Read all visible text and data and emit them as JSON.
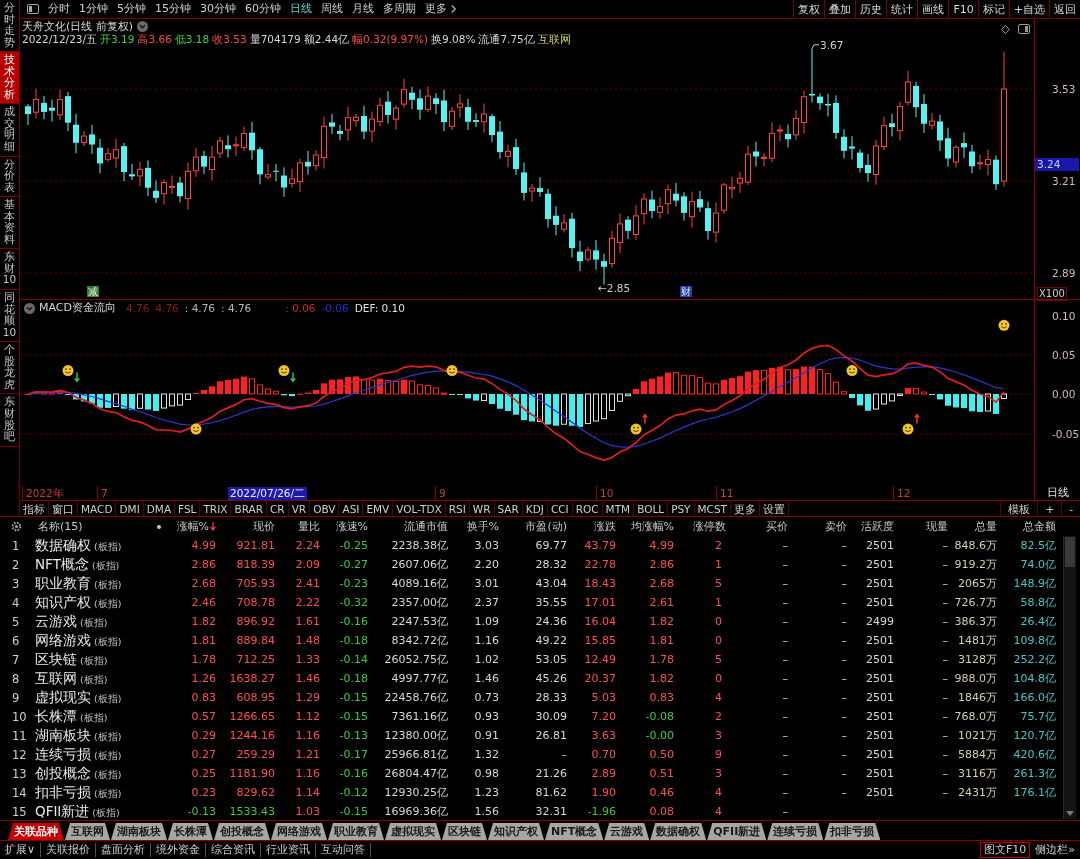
{
  "sidebar": {
    "items": [
      {
        "label": "分时走势",
        "selected": false
      },
      {
        "label": "技术分析",
        "selected": true
      },
      {
        "label": "成交明细",
        "selected": false
      },
      {
        "label": "分价表",
        "selected": false
      },
      {
        "label": "基本资料",
        "selected": false
      },
      {
        "label": "东财10",
        "selected": false
      },
      {
        "label": "同花顺10",
        "selected": false
      },
      {
        "label": "个股龙虎",
        "selected": false
      },
      {
        "label": "东财股吧",
        "selected": false
      }
    ]
  },
  "toolbar": {
    "periods": [
      {
        "label": "分时",
        "selected": false
      },
      {
        "label": "1分钟",
        "selected": false
      },
      {
        "label": "5分钟",
        "selected": false
      },
      {
        "label": "15分钟",
        "selected": false
      },
      {
        "label": "30分钟",
        "selected": false
      },
      {
        "label": "60分钟",
        "selected": false
      },
      {
        "label": "日线",
        "selected": true
      },
      {
        "label": "周线",
        "selected": false
      },
      {
        "label": "月线",
        "selected": false
      },
      {
        "label": "多周期",
        "selected": false
      },
      {
        "label": "更多",
        "selected": false
      }
    ],
    "actions": [
      "复权",
      "叠加",
      "历史",
      "统计",
      "画线",
      "F10",
      "标记",
      "+自选",
      "返回"
    ]
  },
  "price_chart": {
    "title": "天舟文化(日线 前复权)",
    "date": "2022/12/23/五",
    "quote": [
      {
        "label": "开",
        "value": "3.19",
        "color": "#3cd03c"
      },
      {
        "label": "高",
        "value": "3.66",
        "color": "#ff4848"
      },
      {
        "label": "低",
        "value": "3.18",
        "color": "#3cd03c"
      },
      {
        "label": "收",
        "value": "3.53",
        "color": "#ff4848"
      },
      {
        "label": "量",
        "value": "704179",
        "color": "#d8d8d8"
      },
      {
        "label": "额",
        "value": "2.44亿",
        "color": "#d8d8d8"
      },
      {
        "label": "幅",
        "value": "0.32(9.97%)",
        "color": "#ff4848"
      },
      {
        "label": "换",
        "value": "9.08%",
        "color": "#d8d8d8"
      },
      {
        "label": "流通",
        "value": "7.75亿",
        "color": "#d8d8d8"
      }
    ],
    "sector": "互联网",
    "high_label": "3.67",
    "low_label": "←2.85",
    "markers": [
      {
        "text": "减",
        "kind": "reduce"
      },
      {
        "text": "财",
        "kind": "finance"
      }
    ],
    "axis_labels": [
      "3.53",
      "3.21",
      "2.89"
    ],
    "current_price": "3.24",
    "scale_label": "X100"
  },
  "macd_chart": {
    "title": "MACD资金流向",
    "legend": [
      {
        "text": "4.76",
        "color": "#8b1c1c"
      },
      {
        "text": "4.76",
        "color": "#8b1c1c"
      },
      {
        "text": ": 4.76",
        "color": "#b8b8b8"
      },
      {
        "text": ": 4.76",
        "color": "#b8b8b8"
      },
      {
        "text": ": 0.06",
        "color": "#d02424"
      },
      {
        "text": "-0.06",
        "color": "#2a2ad0"
      },
      {
        "text": "DEF: 0.10",
        "color": "#e0e0e0"
      }
    ],
    "axis_labels": [
      "0.10",
      "0.05",
      "0.00",
      "-0.05"
    ]
  },
  "time_axis": {
    "labels": [
      "2022年",
      "7",
      "9",
      "10",
      "11",
      "12"
    ],
    "cursor_date": "2022/07/26/二",
    "period": "日线"
  },
  "indicator_tabs": {
    "items": [
      "指标",
      "窗口",
      "MACD",
      "DMI",
      "DMA",
      "FSL",
      "TRIX",
      "BRAR",
      "CR",
      "VR",
      "OBV",
      "ASI",
      "EMV",
      "VOL-TDX",
      "RSI",
      "WR",
      "SAR",
      "KDJ",
      "CCI",
      "ROC",
      "MTM",
      "BOLL",
      "PSY",
      "MCST",
      "更多",
      "设置"
    ],
    "tools": [
      "模板",
      "+",
      "-"
    ]
  },
  "table": {
    "columns": [
      {
        "label": "名称(15)",
        "kind": "name",
        "sorted": false
      },
      {
        "label": "涨幅%",
        "kind": "signed",
        "sorted": true
      },
      {
        "label": "现价",
        "kind": "signed",
        "sorted": false
      },
      {
        "label": "量比",
        "kind": "signed",
        "sorted": false
      },
      {
        "label": "涨速%",
        "kind": "signed",
        "sorted": false
      },
      {
        "label": "流通市值",
        "kind": "plain",
        "sorted": false
      },
      {
        "label": "换手%",
        "kind": "plain",
        "sorted": false
      },
      {
        "label": "市盈(动)",
        "kind": "plain",
        "sorted": false
      },
      {
        "label": "涨跌",
        "kind": "signed",
        "sorted": false
      },
      {
        "label": "均涨幅%",
        "kind": "signed",
        "sorted": false
      },
      {
        "label": "涨停数",
        "kind": "count",
        "sorted": false
      },
      {
        "label": "买价",
        "kind": "plain",
        "sorted": false
      },
      {
        "label": "卖价",
        "kind": "plain",
        "sorted": false
      },
      {
        "label": "活跃度",
        "kind": "plain",
        "sorted": false
      },
      {
        "label": "现量",
        "kind": "plain",
        "sorted": false
      },
      {
        "label": "总量",
        "kind": "volume",
        "sorted": false
      },
      {
        "label": "总金额",
        "kind": "amount",
        "sorted": false
      }
    ],
    "rows": [
      {
        "rank": "1",
        "cells": [
          {
            "text": "数据确权",
            "tag": "(板指)"
          },
          {
            "text": "4.99",
            "up": true
          },
          {
            "text": "921.81",
            "up": true
          },
          {
            "text": "2.24",
            "up": true
          },
          {
            "text": "-0.25",
            "up": false
          },
          {
            "text": "2238.38亿"
          },
          {
            "text": "3.03"
          },
          {
            "text": "69.77"
          },
          {
            "text": "43.79",
            "up": true
          },
          {
            "text": "4.99",
            "up": true
          },
          {
            "text": "2"
          },
          {
            "text": "–"
          },
          {
            "text": "–"
          },
          {
            "text": "2501"
          },
          {
            "text": "–"
          },
          {
            "text": "848.6万"
          },
          {
            "text": "82.5亿"
          }
        ]
      },
      {
        "rank": "2",
        "cells": [
          {
            "text": "NFT概念",
            "tag": "(板指)"
          },
          {
            "text": "2.86",
            "up": true
          },
          {
            "text": "818.39",
            "up": true
          },
          {
            "text": "2.09",
            "up": true
          },
          {
            "text": "-0.27",
            "up": false
          },
          {
            "text": "2607.06亿"
          },
          {
            "text": "2.20"
          },
          {
            "text": "28.32"
          },
          {
            "text": "22.78",
            "up": true
          },
          {
            "text": "2.86",
            "up": true
          },
          {
            "text": "1"
          },
          {
            "text": "–"
          },
          {
            "text": "–"
          },
          {
            "text": "2501"
          },
          {
            "text": "–"
          },
          {
            "text": "919.2万"
          },
          {
            "text": "74.0亿"
          }
        ]
      },
      {
        "rank": "3",
        "cells": [
          {
            "text": "职业教育",
            "tag": "(板指)"
          },
          {
            "text": "2.68",
            "up": true
          },
          {
            "text": "705.93",
            "up": true
          },
          {
            "text": "2.41",
            "up": true
          },
          {
            "text": "-0.23",
            "up": false
          },
          {
            "text": "4089.16亿"
          },
          {
            "text": "3.01"
          },
          {
            "text": "43.04"
          },
          {
            "text": "18.43",
            "up": true
          },
          {
            "text": "2.68",
            "up": true
          },
          {
            "text": "5"
          },
          {
            "text": "–"
          },
          {
            "text": "–"
          },
          {
            "text": "2501"
          },
          {
            "text": "–"
          },
          {
            "text": "2065万"
          },
          {
            "text": "148.9亿"
          }
        ]
      },
      {
        "rank": "4",
        "cells": [
          {
            "text": "知识产权",
            "tag": "(板指)"
          },
          {
            "text": "2.46",
            "up": true
          },
          {
            "text": "708.78",
            "up": true
          },
          {
            "text": "2.22",
            "up": true
          },
          {
            "text": "-0.32",
            "up": false
          },
          {
            "text": "2357.00亿"
          },
          {
            "text": "2.37"
          },
          {
            "text": "35.55"
          },
          {
            "text": "17.01",
            "up": true
          },
          {
            "text": "2.61",
            "up": true
          },
          {
            "text": "1"
          },
          {
            "text": "–"
          },
          {
            "text": "–"
          },
          {
            "text": "2501"
          },
          {
            "text": "–"
          },
          {
            "text": "726.7万"
          },
          {
            "text": "58.8亿"
          }
        ]
      },
      {
        "rank": "5",
        "cells": [
          {
            "text": "云游戏",
            "tag": "(板指)"
          },
          {
            "text": "1.82",
            "up": true
          },
          {
            "text": "896.92",
            "up": true
          },
          {
            "text": "1.61",
            "up": true
          },
          {
            "text": "-0.16",
            "up": false
          },
          {
            "text": "2247.53亿"
          },
          {
            "text": "1.09"
          },
          {
            "text": "24.36"
          },
          {
            "text": "16.04",
            "up": true
          },
          {
            "text": "1.82",
            "up": true
          },
          {
            "text": "0"
          },
          {
            "text": "–"
          },
          {
            "text": "–"
          },
          {
            "text": "2499"
          },
          {
            "text": "–"
          },
          {
            "text": "386.3万"
          },
          {
            "text": "26.4亿"
          }
        ]
      },
      {
        "rank": "6",
        "cells": [
          {
            "text": "网络游戏",
            "tag": "(板指)"
          },
          {
            "text": "1.81",
            "up": true
          },
          {
            "text": "889.84",
            "up": true
          },
          {
            "text": "1.48",
            "up": true
          },
          {
            "text": "-0.18",
            "up": false
          },
          {
            "text": "8342.72亿"
          },
          {
            "text": "1.16"
          },
          {
            "text": "49.22"
          },
          {
            "text": "15.85",
            "up": true
          },
          {
            "text": "1.81",
            "up": true
          },
          {
            "text": "0"
          },
          {
            "text": "–"
          },
          {
            "text": "–"
          },
          {
            "text": "2501"
          },
          {
            "text": "–"
          },
          {
            "text": "1481万"
          },
          {
            "text": "109.8亿"
          }
        ]
      },
      {
        "rank": "7",
        "cells": [
          {
            "text": "区块链",
            "tag": "(板指)"
          },
          {
            "text": "1.78",
            "up": true
          },
          {
            "text": "712.25",
            "up": true
          },
          {
            "text": "1.33",
            "up": true
          },
          {
            "text": "-0.14",
            "up": false
          },
          {
            "text": "26052.75亿"
          },
          {
            "text": "1.02"
          },
          {
            "text": "53.05"
          },
          {
            "text": "12.49",
            "up": true
          },
          {
            "text": "1.78",
            "up": true
          },
          {
            "text": "5"
          },
          {
            "text": "–"
          },
          {
            "text": "–"
          },
          {
            "text": "2501"
          },
          {
            "text": "–"
          },
          {
            "text": "3128万"
          },
          {
            "text": "252.2亿"
          }
        ]
      },
      {
        "rank": "8",
        "cells": [
          {
            "text": "互联网",
            "tag": "(板指)"
          },
          {
            "text": "1.26",
            "up": true
          },
          {
            "text": "1638.27",
            "up": true
          },
          {
            "text": "1.46",
            "up": true
          },
          {
            "text": "-0.18",
            "up": false
          },
          {
            "text": "4997.77亿"
          },
          {
            "text": "1.46"
          },
          {
            "text": "45.26"
          },
          {
            "text": "20.37",
            "up": true
          },
          {
            "text": "1.82",
            "up": true
          },
          {
            "text": "0"
          },
          {
            "text": "–"
          },
          {
            "text": "–"
          },
          {
            "text": "2501"
          },
          {
            "text": "–"
          },
          {
            "text": "988.0万"
          },
          {
            "text": "104.8亿"
          }
        ]
      },
      {
        "rank": "9",
        "cells": [
          {
            "text": "虚拟现实",
            "tag": "(板指)"
          },
          {
            "text": "0.83",
            "up": true
          },
          {
            "text": "608.95",
            "up": true
          },
          {
            "text": "1.29",
            "up": true
          },
          {
            "text": "-0.15",
            "up": false
          },
          {
            "text": "22458.76亿"
          },
          {
            "text": "0.73"
          },
          {
            "text": "28.33"
          },
          {
            "text": "5.03",
            "up": true
          },
          {
            "text": "0.83",
            "up": true
          },
          {
            "text": "4"
          },
          {
            "text": "–"
          },
          {
            "text": "–"
          },
          {
            "text": "2501"
          },
          {
            "text": "–"
          },
          {
            "text": "1846万"
          },
          {
            "text": "166.0亿"
          }
        ]
      },
      {
        "rank": "10",
        "cells": [
          {
            "text": "长株潭",
            "tag": "(板指)"
          },
          {
            "text": "0.57",
            "up": true
          },
          {
            "text": "1266.65",
            "up": true
          },
          {
            "text": "1.12",
            "up": true
          },
          {
            "text": "-0.15",
            "up": false
          },
          {
            "text": "7361.16亿"
          },
          {
            "text": "0.93"
          },
          {
            "text": "30.09"
          },
          {
            "text": "7.20",
            "up": true
          },
          {
            "text": "-0.08",
            "up": false
          },
          {
            "text": "2"
          },
          {
            "text": "–"
          },
          {
            "text": "–"
          },
          {
            "text": "2501"
          },
          {
            "text": "–"
          },
          {
            "text": "768.0万"
          },
          {
            "text": "75.7亿"
          }
        ]
      },
      {
        "rank": "11",
        "cells": [
          {
            "text": "湖南板块",
            "tag": "(板指)"
          },
          {
            "text": "0.29",
            "up": true
          },
          {
            "text": "1244.16",
            "up": true
          },
          {
            "text": "1.16",
            "up": true
          },
          {
            "text": "-0.13",
            "up": false
          },
          {
            "text": "12380.00亿"
          },
          {
            "text": "0.91"
          },
          {
            "text": "26.81"
          },
          {
            "text": "3.63",
            "up": true
          },
          {
            "text": "-0.00",
            "up": false
          },
          {
            "text": "3"
          },
          {
            "text": "–"
          },
          {
            "text": "–"
          },
          {
            "text": "2501"
          },
          {
            "text": "–"
          },
          {
            "text": "1021万"
          },
          {
            "text": "120.7亿"
          }
        ]
      },
      {
        "rank": "12",
        "cells": [
          {
            "text": "连续亏损",
            "tag": "(板指)"
          },
          {
            "text": "0.27",
            "up": true
          },
          {
            "text": "259.29",
            "up": true
          },
          {
            "text": "1.21",
            "up": true
          },
          {
            "text": "-0.17",
            "up": false
          },
          {
            "text": "25966.81亿"
          },
          {
            "text": "1.32"
          },
          {
            "text": "–"
          },
          {
            "text": "0.70",
            "up": true
          },
          {
            "text": "0.50",
            "up": true
          },
          {
            "text": "9"
          },
          {
            "text": "–"
          },
          {
            "text": "–"
          },
          {
            "text": "2501"
          },
          {
            "text": "–"
          },
          {
            "text": "5884万"
          },
          {
            "text": "420.6亿"
          }
        ]
      },
      {
        "rank": "13",
        "cells": [
          {
            "text": "创投概念",
            "tag": "(板指)"
          },
          {
            "text": "0.25",
            "up": true
          },
          {
            "text": "1181.90",
            "up": true
          },
          {
            "text": "1.16",
            "up": true
          },
          {
            "text": "-0.16",
            "up": false
          },
          {
            "text": "26804.47亿"
          },
          {
            "text": "0.98"
          },
          {
            "text": "21.26"
          },
          {
            "text": "2.89",
            "up": true
          },
          {
            "text": "0.51",
            "up": true
          },
          {
            "text": "3"
          },
          {
            "text": "–"
          },
          {
            "text": "–"
          },
          {
            "text": "2501"
          },
          {
            "text": "–"
          },
          {
            "text": "3116万"
          },
          {
            "text": "261.3亿"
          }
        ]
      },
      {
        "rank": "14",
        "cells": [
          {
            "text": "扣非亏损",
            "tag": "(板指)"
          },
          {
            "text": "0.23",
            "up": true
          },
          {
            "text": "829.62",
            "up": true
          },
          {
            "text": "1.14",
            "up": true
          },
          {
            "text": "-0.12",
            "up": false
          },
          {
            "text": "12930.25亿"
          },
          {
            "text": "1.23"
          },
          {
            "text": "81.62"
          },
          {
            "text": "1.90",
            "up": true
          },
          {
            "text": "0.46",
            "up": true
          },
          {
            "text": "4"
          },
          {
            "text": "–"
          },
          {
            "text": "–"
          },
          {
            "text": "2501"
          },
          {
            "text": "–"
          },
          {
            "text": "2431万"
          },
          {
            "text": "176.1亿"
          }
        ]
      },
      {
        "rank": "15",
        "cells": [
          {
            "text": "QFII新进",
            "tag": "(板指)"
          },
          {
            "text": "-0.13",
            "up": false
          },
          {
            "text": "1533.43",
            "up": false
          },
          {
            "text": "1.03",
            "up": true
          },
          {
            "text": "-0.15",
            "up": false
          },
          {
            "text": "16969.36亿"
          },
          {
            "text": "1.56"
          },
          {
            "text": "32.31"
          },
          {
            "text": "-1.96",
            "up": false
          },
          {
            "text": "0.08",
            "up": true
          },
          {
            "text": "4"
          },
          {
            "text": "–"
          }
        ]
      }
    ]
  },
  "related_tabs": [
    {
      "label": "关联品种",
      "selected": true
    },
    {
      "label": "互联网",
      "selected": false
    },
    {
      "label": "湖南板块",
      "selected": false
    },
    {
      "label": "长株潭",
      "selected": false
    },
    {
      "label": "创投概念",
      "selected": false
    },
    {
      "label": "网络游戏",
      "selected": false
    },
    {
      "label": "职业教育",
      "selected": false
    },
    {
      "label": "虚拟现实",
      "selected": false
    },
    {
      "label": "区块链",
      "selected": false
    },
    {
      "label": "知识产权",
      "selected": false
    },
    {
      "label": "NFT概念",
      "selected": false
    },
    {
      "label": "云游戏",
      "selected": false
    },
    {
      "label": "数据确权",
      "selected": false
    },
    {
      "label": "QFII新进",
      "selected": false
    },
    {
      "label": "连续亏损",
      "selected": false
    },
    {
      "label": "扣非亏损",
      "selected": false
    }
  ],
  "status_bar": {
    "items": [
      "扩展∨",
      "关联报价",
      "盘面分析",
      "境外资金",
      "综合资讯",
      "行业资讯",
      "互动问答"
    ],
    "right": [
      "图文F10",
      "侧边栏»"
    ]
  }
}
